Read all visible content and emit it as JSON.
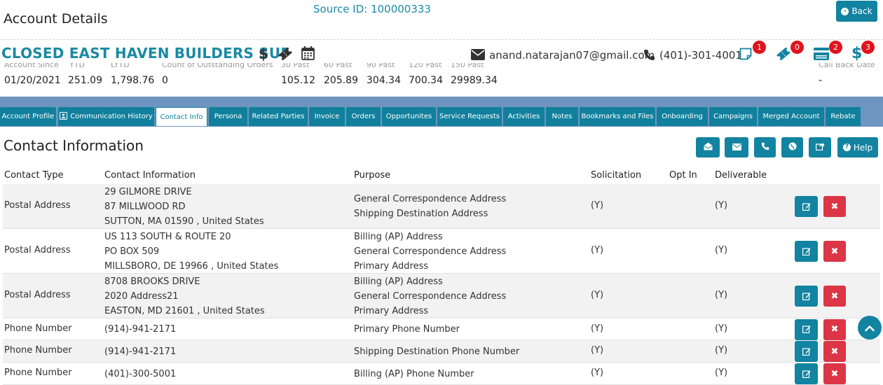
{
  "header": {
    "title": "Account Details",
    "source_id": "Source ID: 100000333",
    "back_label": "Back"
  },
  "account": {
    "name": "CLOSED EAST HAVEN BUILDERS SUP",
    "email": "anand.natarajan07@gmail.com",
    "phone": "(401)-301-4001",
    "badges": {
      "notes": "1",
      "tickets": "0",
      "cards": "2",
      "dollars": "3"
    }
  },
  "stats": {
    "labels": [
      "Account Since",
      "YTD",
      "LYTD",
      "Count of Outstanding Orders",
      "30 Past",
      "60 Past",
      "90 Past",
      "120 Past",
      "150 Past",
      "Call Back Date"
    ],
    "values": [
      "01/20/2021",
      "251.09",
      "1,798.76",
      "0",
      "105.12",
      "205.89",
      "304.34",
      "700.34",
      "29989.34",
      "-"
    ]
  },
  "tabs": [
    "Account Profile",
    "Communication History",
    "Contact Info",
    "Persona",
    "Related Parties",
    "Invoice",
    "Orders",
    "Opportunites",
    "Service Requests",
    "Activities",
    "Notes",
    "Bookmarks and Files",
    "Onboarding",
    "Campaigns",
    "Merged Account",
    "Rebate"
  ],
  "active_tab": "Contact Info",
  "section": {
    "title": "Contact Information",
    "help_label": "Help"
  },
  "table": {
    "headers": [
      "Contact Type",
      "Contact Information",
      "Purpose",
      "Solicitation",
      "Opt In",
      "Deliverable"
    ],
    "rows": [
      {
        "type": "Postal Address",
        "info": [
          "29 GILMORE DRIVE",
          "87 MILLWOOD RD",
          "SUTTON, MA 01590 , United States"
        ],
        "purpose": [
          "General Correspondence Address",
          "Shipping Destination Address"
        ],
        "solicitation": "(Y)",
        "optin": "",
        "deliverable": "(Y)"
      },
      {
        "type": "Postal Address",
        "info": [
          "US 113 SOUTH & ROUTE 20",
          "PO BOX 509",
          "MILLSBORO, DE 19966 , United States"
        ],
        "purpose": [
          "Billing (AP) Address",
          "General Correspondence Address",
          "Primary Address"
        ],
        "solicitation": "(Y)",
        "optin": "",
        "deliverable": "(Y)"
      },
      {
        "type": "Postal Address",
        "info": [
          "8708 BROOKS DRIVE",
          "2020 Address21",
          "EASTON, MD 21601 , United States"
        ],
        "purpose": [
          "Billing (AP) Address",
          "General Correspondence Address",
          "Primary Address"
        ],
        "solicitation": "(Y)",
        "optin": "",
        "deliverable": "(Y)"
      },
      {
        "type": "Phone Number",
        "info": [
          "(914)-941-2171"
        ],
        "purpose": [
          "Primary Phone Number"
        ],
        "solicitation": "(Y)",
        "optin": "",
        "deliverable": "(Y)"
      },
      {
        "type": "Phone Number",
        "info": [
          "(914)-941-2171"
        ],
        "purpose": [
          "Shipping Destination Phone Number"
        ],
        "solicitation": "(Y)",
        "optin": "",
        "deliverable": "(Y)"
      },
      {
        "type": "Phone Number",
        "info": [
          "(401)-300-5001"
        ],
        "purpose": [
          "Billing (AP) Phone Number"
        ],
        "solicitation": "(Y)",
        "optin": "",
        "deliverable": "(Y)"
      }
    ]
  },
  "colors": {
    "accent": "#1283a0",
    "link": "#1a8aa3",
    "danger": "#dc3545",
    "badge": "#e0141e",
    "tabbar": "#6e95bf"
  }
}
